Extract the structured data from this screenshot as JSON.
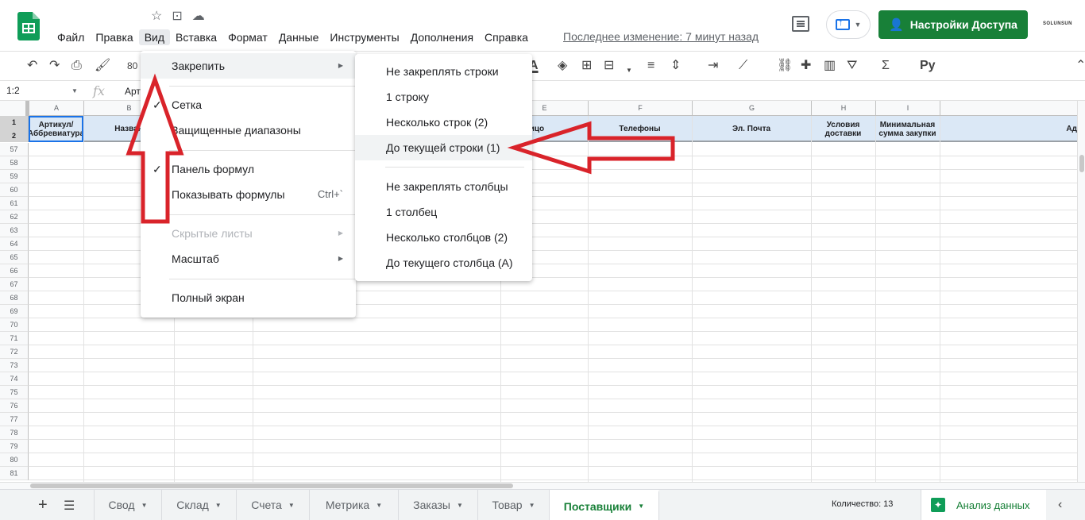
{
  "app": {
    "logo": "google-sheets-logo",
    "doc_icons": [
      "star-icon",
      "move-folder-icon",
      "cloud-saved-icon"
    ],
    "menu": [
      "Файл",
      "Правка",
      "Вид",
      "Вставка",
      "Формат",
      "Данные",
      "Инструменты",
      "Дополнения",
      "Справка"
    ],
    "last_edit": "Последнее изменение: 7 минут назад",
    "share_label": "Настройки Доступа",
    "brand": "SOLUNSUN",
    "accent": "#188038"
  },
  "toolbar": {
    "zoom": "80"
  },
  "formula_bar": {
    "name_box": "1:2",
    "fx": "fx",
    "value": "Арт"
  },
  "grid": {
    "columns": [
      "A",
      "B",
      "E",
      "F",
      "G",
      "H",
      "I"
    ],
    "header_row": {
      "a": "Артикул/Аббревиатура",
      "b": "Назван",
      "e": "ктное лицо",
      "f": "Телефоны",
      "g": "Эл. Почта",
      "h": "Условия доставки",
      "i": "Минимальная сумма закупки",
      "j": "Ад"
    },
    "frozen_rows": [
      "1",
      "2"
    ],
    "rows": [
      "57",
      "58",
      "59",
      "60",
      "61",
      "62",
      "63",
      "64",
      "65",
      "66",
      "67",
      "68",
      "69",
      "70",
      "71",
      "72",
      "73",
      "74",
      "75",
      "76",
      "77",
      "78",
      "79",
      "80",
      "81"
    ]
  },
  "view_menu": {
    "freeze": "Закрепить",
    "gridlines": "Сетка",
    "protected": "Защищенные диапазоны",
    "formula_bar": "Панель формул",
    "show_formulas": "Показывать формулы",
    "show_formulas_shortcut": "Ctrl+`",
    "hidden_sheets": "Скрытые листы",
    "zoom": "Масштаб",
    "full_screen": "Полный экран"
  },
  "freeze_menu": {
    "no_rows": "Не закреплять строки",
    "one_row": "1 строку",
    "rows_2": "Несколько строк (2)",
    "up_to_current_row": "До текущей строки (1)",
    "no_cols": "Не закреплять столбцы",
    "one_col": "1 столбец",
    "cols_2": "Несколько столбцов (2)",
    "up_to_current_col": "До текущего столбца (A)"
  },
  "sheets": [
    "Свод",
    "Склад",
    "Счета",
    "Метрика",
    "Заказы",
    "Товар",
    "Поставщики"
  ],
  "status": {
    "count": "Количество: 13",
    "explore": "Анализ данных"
  },
  "annotation": {
    "arrow_color": "#d9232a"
  }
}
